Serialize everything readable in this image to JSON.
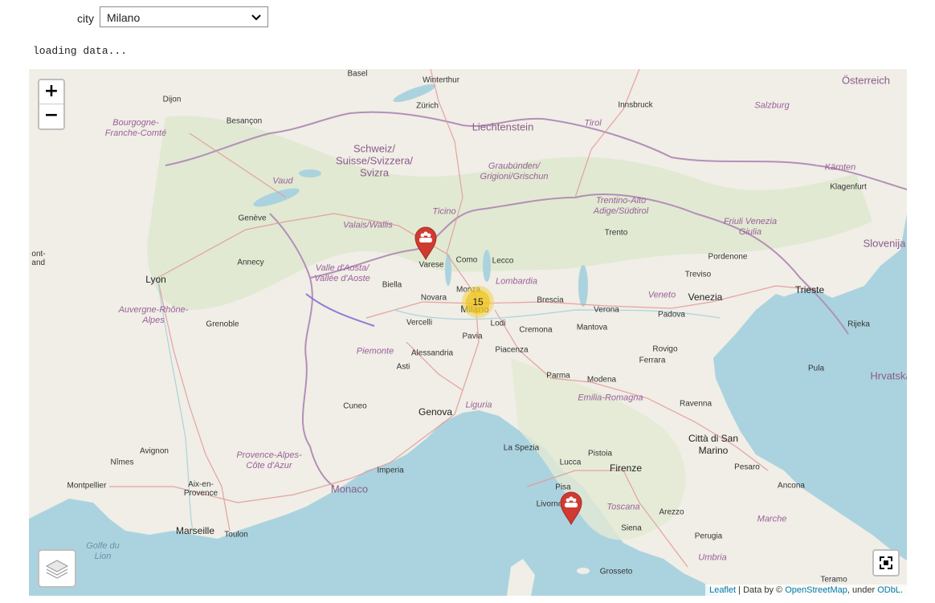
{
  "controls": {
    "city_label": "city",
    "city_value": "Milano"
  },
  "status_text": "loading data...",
  "map": {
    "zoom_in": "+",
    "zoom_out": "−",
    "cluster_count": "15",
    "attribution": {
      "leaflet": "Leaflet",
      "data_by": " | Data by © ",
      "osm": "OpenStreetMap",
      "under": ", under ",
      "odbl": "ODbL",
      "end": "."
    },
    "places": {
      "basel": "Basel",
      "winterthur": "Winterthur",
      "zurich": "Zürich",
      "dijon": "Dijon",
      "besancon": "Besançon",
      "liechtenstein": "Liechtenstein",
      "innsbruck": "Innsbruck",
      "oesterreich": "Österreich",
      "salzburg": "Salzburg",
      "tirol": "Tirol",
      "schweiz": "Schweiz/\nSuisse/Svizzera/\nSvizra",
      "bourgogne": "Bourgogne-\nFranche-Comté",
      "graubunden": "Graubünden/\nGrigioni/Grischun",
      "vaud": "Vaud",
      "geneve": "Genève",
      "annecy": "Annecy",
      "lyon": "Lyon",
      "kaernten": "Kärnten",
      "klagenfurt": "Klagenfurt",
      "ticino": "Ticino",
      "valais": "Valais/Wallis",
      "trentino": "Trentino-Alto\nAdige/Südtirol",
      "friuli": "Friuli Venezia\nGiulia",
      "trento": "Trento",
      "pordenone": "Pordenone",
      "slovenija": "Slovenija",
      "varese": "Varese",
      "como": "Como",
      "lecco": "Lecco",
      "valle_aosta": "Valle d'Aosta/\nVallée d'Aoste",
      "biella": "Biella",
      "monza": "Monza",
      "lombardia": "Lombardia",
      "treviso": "Treviso",
      "trieste": "Trieste",
      "venezia": "Venezia",
      "veneto": "Veneto",
      "novara": "Novara",
      "milano": "Milano",
      "brescia": "Brescia",
      "verona": "Verona",
      "padova": "Padova",
      "auvergne": "Auvergne-Rhône-\nAlpes",
      "grenoble": "Grenoble",
      "vercelli": "Vercelli",
      "lodi": "Lodi",
      "cremona": "Cremona",
      "mantova": "Mantova",
      "rijeka": "Rijeka",
      "pavia": "Pavia",
      "piemonte": "Piemonte",
      "alessandria": "Alessandria",
      "piacenza": "Piacenza",
      "rovigo": "Rovigo",
      "ferrara": "Ferrara",
      "asti": "Asti",
      "pula": "Pula",
      "hrvatska": "Hrvatska",
      "parma": "Parma",
      "modena": "Modena",
      "emilia": "Emilia-Romagna",
      "ravenna": "Ravenna",
      "cuneo": "Cuneo",
      "genova": "Genova",
      "liguria": "Liguria",
      "citta_san_marino": "Città di San\nMarino",
      "avignon": "Avignon",
      "provence": "Provence-Alpes-\nCôte d'Azur",
      "la_spezia": "La Spezia",
      "pistoia": "Pistoia",
      "pesaro": "Pesaro",
      "nimes": "Nîmes",
      "imperia": "Imperia",
      "lucca": "Lucca",
      "firenze": "Firenze",
      "montpellier": "Montpellier",
      "aix": "Aix-en-\nProvence",
      "monaco": "Monaco",
      "pisa": "Pisa",
      "ancona": "Ancona",
      "livorno": "Livorno",
      "toscana": "Toscana",
      "arezzo": "Arezzo",
      "marche": "Marche",
      "marseille": "Marseille",
      "toulon": "Toulon",
      "siena": "Siena",
      "perugia": "Perugia",
      "golfe": "Golfe du\nLion",
      "umbria": "Umbria",
      "grosseto": "Grosseto",
      "teramo": "Teramo",
      "pont": "ont-\nand"
    }
  }
}
